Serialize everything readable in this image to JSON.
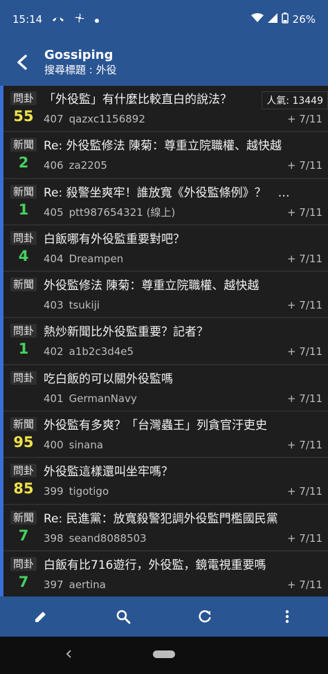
{
  "status_bar": {
    "time": "15:14",
    "battery": "26%",
    "left_icons": [
      "missed-call-icon",
      "fan-icon",
      "dot-icon"
    ],
    "right_icons": [
      "wifi-icon",
      "signal-icon",
      "battery-icon"
    ]
  },
  "app_bar": {
    "title": "Gossiping",
    "subtitle": "搜尋標題 : 外役"
  },
  "popularity": "人氣: 13449",
  "posts": [
    {
      "tag": "問卦",
      "count": "55",
      "count_color": "yellow",
      "title": "「外役監」有什麼比較直白的說法？",
      "num": "407",
      "author": "qazxc1156892",
      "date": "+ 7/11"
    },
    {
      "tag": "新聞",
      "count": "2",
      "count_color": "green",
      "title": "Re: 外役監修法 陳菊：尊重立院職權、越快越",
      "num": "406",
      "author": "za2205",
      "date": "+ 7/11"
    },
    {
      "tag": "新聞",
      "count": "1",
      "count_color": "green",
      "title": "Re: 殺警坐爽牢！誰放寬《外役監條例》？　…",
      "num": "405",
      "author": "ptt987654321 (線上)",
      "date": "+ 7/11"
    },
    {
      "tag": "問卦",
      "count": "4",
      "count_color": "green",
      "title": "白飯哪有外役監重要對吧？",
      "num": "404",
      "author": "Dreampen",
      "date": "+ 7/11"
    },
    {
      "tag": "新聞",
      "count": "",
      "count_color": "green",
      "title": "外役監修法 陳菊：尊重立院職權、越快越",
      "num": "403",
      "author": "tsukiji",
      "date": "+ 7/11"
    },
    {
      "tag": "問卦",
      "count": "1",
      "count_color": "green",
      "title": "熱炒新聞比外役監重要？記者？",
      "num": "402",
      "author": "a1b2c3d4e5",
      "date": "+ 7/11"
    },
    {
      "tag": "問卦",
      "count": "",
      "count_color": "green",
      "title": "吃白飯的可以關外役監嗎",
      "num": "401",
      "author": "GermanNavy",
      "date": "+ 7/11"
    },
    {
      "tag": "新聞",
      "count": "95",
      "count_color": "yellow",
      "title": "外役監有多爽？「台灣蟲王」列貪官汙吏史",
      "num": "400",
      "author": "sinana",
      "date": "+ 7/11"
    },
    {
      "tag": "問卦",
      "count": "85",
      "count_color": "yellow",
      "title": "外役監這樣還叫坐牢嗎？",
      "num": "399",
      "author": "tigotigo",
      "date": "+ 7/11"
    },
    {
      "tag": "新聞",
      "count": "7",
      "count_color": "green",
      "title": "Re: 民進黨：放寬殺警犯調外役監門檻國民黨",
      "num": "398",
      "author": "seand8088503",
      "date": "+ 7/11"
    },
    {
      "tag": "問卦",
      "count": "7",
      "count_color": "green",
      "title": "白飯有比716遊行，外役監，鏡電視重要嗎",
      "num": "397",
      "author": "aertina",
      "date": "+ 7/11"
    }
  ],
  "bottom_bar": {
    "buttons": [
      "edit-icon",
      "search-icon",
      "refresh-icon",
      "more-vert-icon"
    ]
  },
  "colors": {
    "primary": "#2a5593",
    "accent_stripe": "#3a6fd8",
    "count_green": "#46d160",
    "count_yellow": "#f0e14a"
  }
}
